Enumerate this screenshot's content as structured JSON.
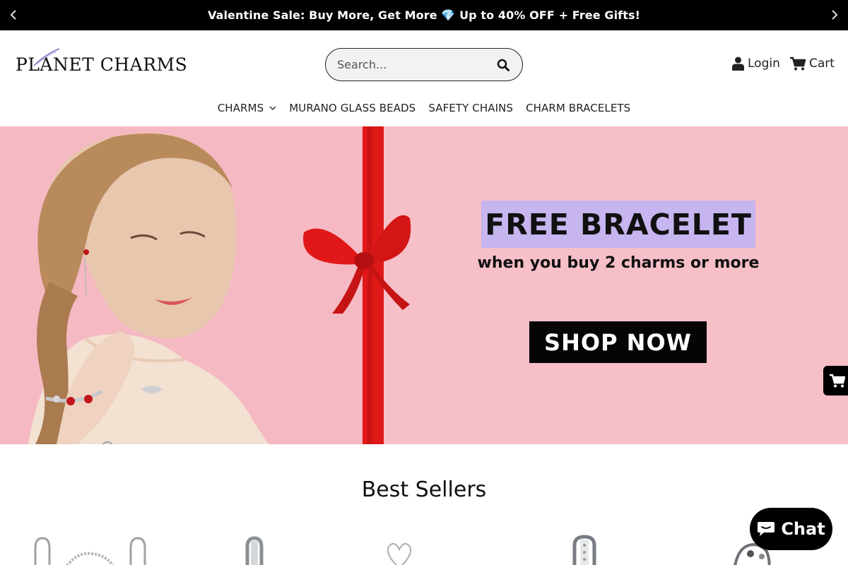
{
  "announcement": {
    "text": "Valentine Sale: Buy More, Get More 💎 Up to 40% OFF + Free Gifts!",
    "prev_icon": "chevron-left-icon",
    "next_icon": "chevron-right-icon"
  },
  "header": {
    "logo_text": "PLANET CHARMS",
    "search": {
      "placeholder": "Search...",
      "value": ""
    },
    "login_label": "Login",
    "cart_label": "Cart"
  },
  "nav": {
    "items": [
      {
        "label": "CHARMS",
        "has_dropdown": true
      },
      {
        "label": "MURANO GLASS BEADS"
      },
      {
        "label": "SAFETY CHAINS"
      },
      {
        "label": "CHARM BRACELETS"
      }
    ]
  },
  "hero": {
    "headline": "FREE BRACELET",
    "subline": "when you buy 2 charms or more",
    "cta": "SHOP NOW",
    "background": "#f7bfc8",
    "accent": "#c7b5ef",
    "ribbon_color": "#e01818"
  },
  "best_sellers": {
    "title": "Best Sellers"
  },
  "chat": {
    "label": "Chat"
  }
}
